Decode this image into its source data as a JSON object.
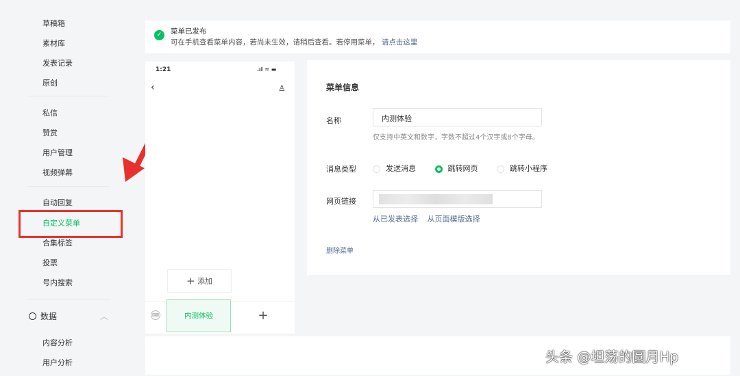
{
  "sidebar": {
    "items": [
      "草稿箱",
      "素材库",
      "发表记录",
      "原创",
      "私信",
      "赞赏",
      "用户管理",
      "视频弹幕",
      "自动回复",
      "自定义菜单",
      "合集标签",
      "投票",
      "号内搜索"
    ],
    "data_section": "数据",
    "data_items": [
      "内容分析",
      "用户分析"
    ]
  },
  "notice": {
    "title": "菜单已发布",
    "text": "可在手机查看菜单内容，若尚未生效，请稍后查看。若停用菜单，",
    "link": "请点击这里"
  },
  "phone": {
    "time": "1:21",
    "add_label": "添加",
    "menu_item": "内测体验",
    "plus": "+"
  },
  "info": {
    "title": "菜单信息",
    "name_label": "名称",
    "name_value": "内测体验",
    "name_hint": "仅支持中英文和数字，字数不超过4个汉字或8个字母。",
    "type_label": "消息类型",
    "types": [
      "发送消息",
      "跳转网页",
      "跳转小程序"
    ],
    "selected_type": "跳转网页",
    "url_label": "网页链接",
    "select_published": "从已发表选择",
    "select_template": "从页面模版选择",
    "delete": "删除菜单"
  },
  "watermark": "头条 @坦荡的圆月Hp",
  "colors": {
    "accent": "#07c160",
    "annotation": "#e8312c",
    "link": "#576b95"
  }
}
